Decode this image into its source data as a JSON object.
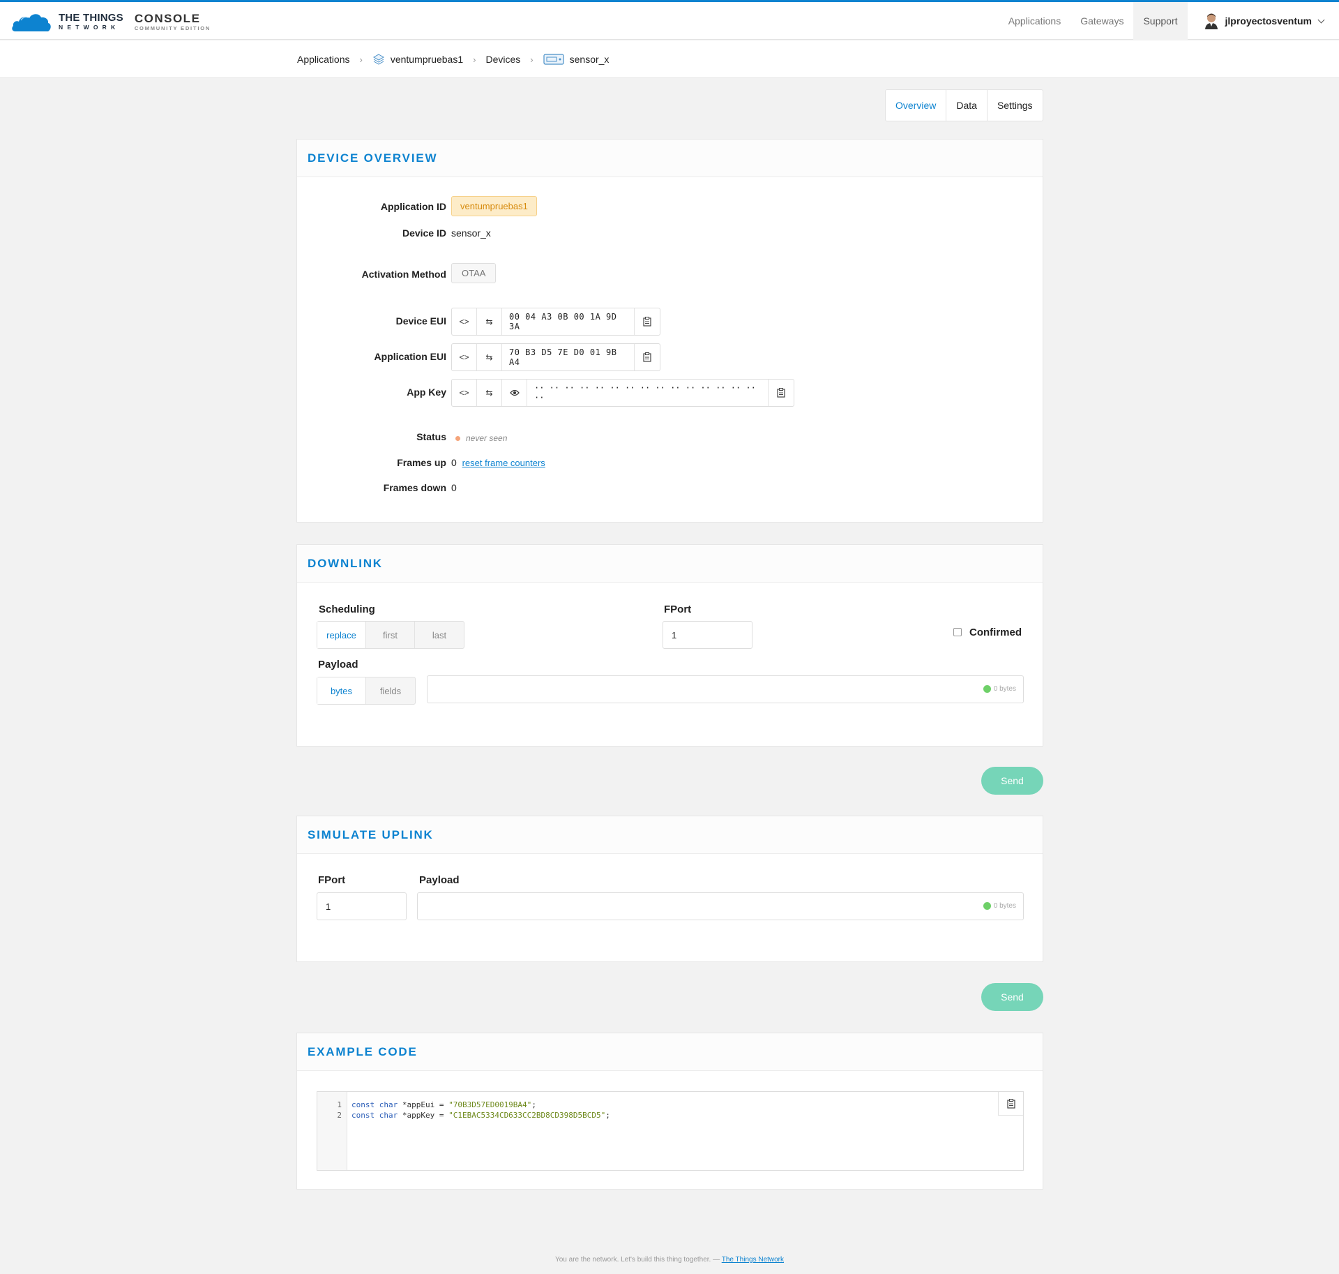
{
  "brand": {
    "line1": "THE THINGS",
    "line2": "NETWORK",
    "console": "CONSOLE",
    "edition": "COMMUNITY EDITION"
  },
  "nav": {
    "applications": "Applications",
    "gateways": "Gateways",
    "support": "Support",
    "user": "jlproyectosventum"
  },
  "breadcrumb": {
    "applications": "Applications",
    "app": "ventumpruebas1",
    "devices": "Devices",
    "device": "sensor_x"
  },
  "tabs": {
    "overview": "Overview",
    "data": "Data",
    "settings": "Settings"
  },
  "overview": {
    "title": "DEVICE OVERVIEW",
    "application_id_label": "Application ID",
    "application_id": "ventumpruebas1",
    "device_id_label": "Device ID",
    "device_id": "sensor_x",
    "activation_label": "Activation Method",
    "activation": "OTAA",
    "device_eui_label": "Device EUI",
    "device_eui": "00 04 A3 0B 00 1A 9D 3A",
    "app_eui_label": "Application EUI",
    "app_eui": "70 B3 D5 7E D0 01 9B A4",
    "app_key_label": "App Key",
    "app_key_masked": "·· ·· ·· ·· ·· ·· ·· ·· ·· ·· ·· ·· ·· ·· ·· ··",
    "status_label": "Status",
    "status": "never seen",
    "frames_up_label": "Frames up",
    "frames_up": "0",
    "reset_link": "reset frame counters",
    "frames_down_label": "Frames down",
    "frames_down": "0",
    "status_color": "#f5a47a"
  },
  "downlink": {
    "title": "DOWNLINK",
    "scheduling_label": "Scheduling",
    "scheduling_options": [
      "replace",
      "first",
      "last"
    ],
    "fport_label": "FPort",
    "fport": "1",
    "confirmed_label": "Confirmed",
    "payload_label": "Payload",
    "payload_modes": [
      "bytes",
      "fields"
    ],
    "bytes_count": "0 bytes",
    "send": "Send"
  },
  "uplink": {
    "title": "SIMULATE UPLINK",
    "fport_label": "FPort",
    "fport": "1",
    "payload_label": "Payload",
    "bytes_count": "0 bytes",
    "send": "Send"
  },
  "example": {
    "title": "EXAMPLE CODE",
    "line_numbers": [
      "1",
      "2"
    ],
    "line1_kw": "const char",
    "line1_var": " *appEui = ",
    "line1_str": "\"70B3D57ED0019BA4\"",
    "line1_end": ";",
    "line2_kw": "const char",
    "line2_var": " *appKey = ",
    "line2_str": "\"C1EBAC5334CD633CC2BD8CD398D5BCD5\"",
    "line2_end": ";"
  },
  "footer": {
    "text": "You are the network. Let's build this thing together. — ",
    "link": "The Things Network"
  },
  "colors": {
    "accent": "#0d83d0",
    "send": "#76d5b8",
    "app_badge": "#fdecc8"
  }
}
